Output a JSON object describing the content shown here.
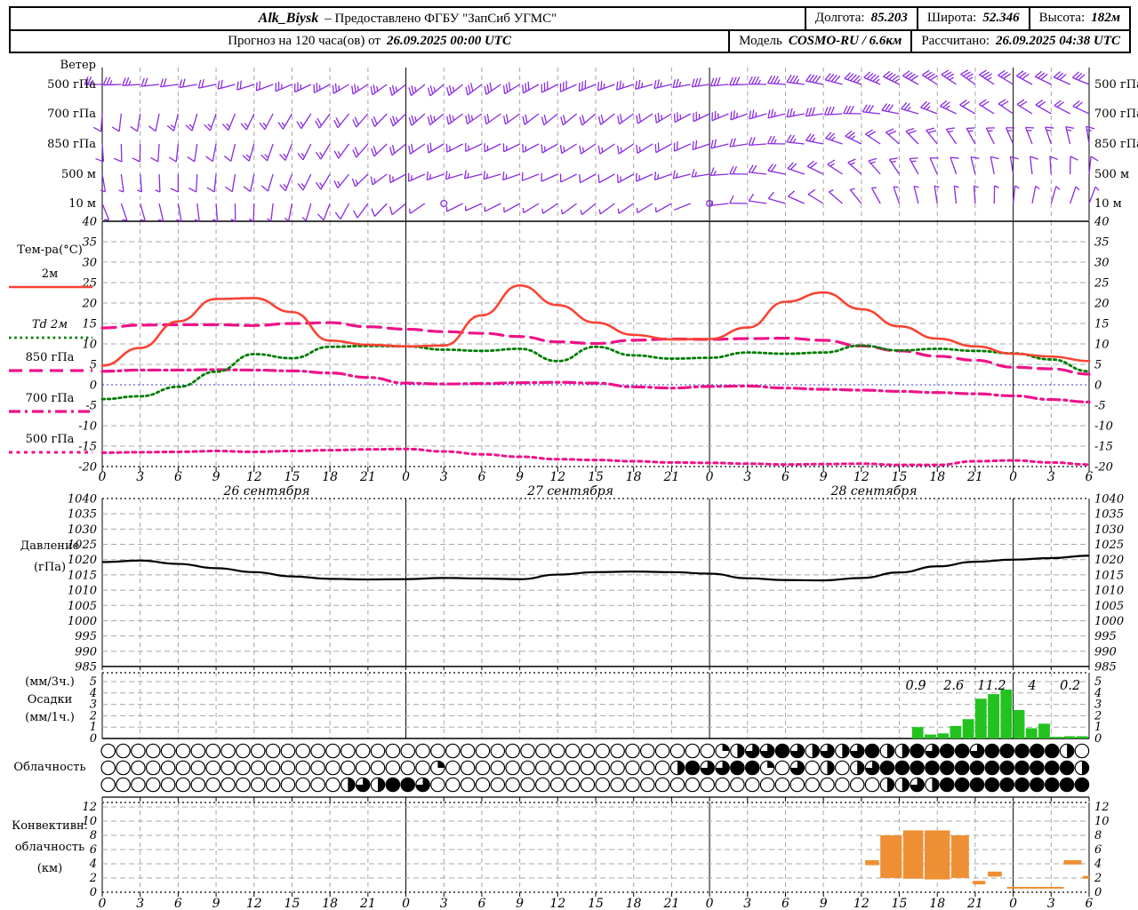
{
  "header": {
    "station": "Alk_Biysk",
    "provider": "–  Предоставлено ФГБУ \"ЗапСиб УГМС\"",
    "lon_label": "Долгота:",
    "lon": "85.203",
    "lat_label": "Широта:",
    "lat": "52.346",
    "alt_label": "Высота:",
    "alt": "182м",
    "forecast_label": "Прогноз на 120 часа(ов) от",
    "forecast_start": "26.09.2025 00:00 UTC",
    "model_label": "Модель",
    "model": "COSMO-RU / 6.6км",
    "calc_label": "Рассчитано:",
    "calc_time": "26.09.2025 04:38 UTC"
  },
  "panels": {
    "wind": {
      "title": "Ветер",
      "levels": [
        "500 гПа",
        "700 гПа",
        "850 гПа",
        "500 м",
        "10 м"
      ]
    },
    "temp": {
      "title": "Тем-ра(°C)",
      "legend": [
        "2м",
        "Td  2м",
        "850 гПа",
        "700 гПа",
        "500 гПа"
      ]
    },
    "pressure": {
      "line1": "Давление",
      "line2": "(гПа)"
    },
    "precip": {
      "line1": "(мм/3ч.)",
      "line2": "Осадки",
      "line3": "(мм/1ч.)"
    },
    "cloud": {
      "title": "Облачность"
    },
    "conv": {
      "line1": "Конвективн.",
      "line2": "облачность",
      "line3": "(км)"
    }
  },
  "chart_data": {
    "type": "meteogram",
    "x_hours": {
      "start": 0,
      "end": 78,
      "step": 3
    },
    "x_tick_labels": [
      "0",
      "3",
      "6",
      "9",
      "12",
      "15",
      "18",
      "21",
      "0",
      "3",
      "6",
      "9",
      "12",
      "15",
      "18",
      "21",
      "0",
      "3",
      "6",
      "9",
      "12",
      "15",
      "18",
      "21",
      "0",
      "3",
      "6"
    ],
    "dates": [
      "26 сентября",
      "27 сентября",
      "28 сентября"
    ],
    "colors": {
      "wind": "#8a2be2",
      "temp2m": "#f94334",
      "dewpoint": "#007c00",
      "pink": "#ee1289",
      "pressure": "#000000",
      "precip": "#22c31f",
      "conv": "#ef8f33",
      "grid": "#a8a8a8",
      "zero_line": "#3333ee"
    },
    "temperature": {
      "ylim": [
        -20,
        40
      ],
      "yticks": [
        40,
        35,
        30,
        25,
        20,
        15,
        10,
        5,
        0,
        -5,
        -10,
        -15,
        -20
      ],
      "series": [
        {
          "name": "2м",
          "style": "solid",
          "color": "#f94334",
          "values": [
            4.7,
            9,
            15.5,
            21,
            21.2,
            17.8,
            10.8,
            9.8,
            9.4,
            9.6,
            17,
            24.3,
            19.5,
            15.2,
            12.2,
            11.1,
            11.2,
            14,
            20.3,
            22.6,
            18.5,
            14.3,
            11.3,
            9.4,
            7.6,
            6.9,
            5.8
          ]
        },
        {
          "name": "Td 2м",
          "style": "dotted",
          "color": "#007c00",
          "values": [
            -3.5,
            -2.8,
            -0.5,
            3.2,
            7.5,
            6.5,
            9.3,
            9.5,
            9.4,
            8.6,
            8.3,
            8.8,
            5.8,
            9.3,
            7.2,
            6.4,
            6.6,
            7.9,
            7.6,
            7.9,
            9.6,
            8.4,
            8.8,
            8.3,
            7.7,
            6.2,
            3.3
          ]
        },
        {
          "name": "850 гПа",
          "style": "longdash",
          "color": "#ee1289",
          "values": [
            13.9,
            14.6,
            14.7,
            14.7,
            14.5,
            15.0,
            15.2,
            14.2,
            13.6,
            13.0,
            12.6,
            11.8,
            10.5,
            10.1,
            10.9,
            11.2,
            11.1,
            11.3,
            11.4,
            10.9,
            9.5,
            8.3,
            7.0,
            6.0,
            4.3,
            3.9,
            2.6
          ]
        },
        {
          "name": "700 гПа",
          "style": "dashdot",
          "color": "#ee1289",
          "values": [
            3.3,
            3.6,
            3.6,
            3.7,
            3.6,
            3.4,
            2.9,
            1.8,
            0.4,
            0.2,
            0.3,
            0.5,
            0.6,
            0.4,
            -0.5,
            -0.8,
            -0.4,
            -0.3,
            -0.8,
            -1.1,
            -1.3,
            -1.6,
            -1.9,
            -2.2,
            -2.7,
            -3.6,
            -4.2
          ]
        },
        {
          "name": "500 гПа",
          "style": "shortdash",
          "color": "#ee1289",
          "values": [
            -16.6,
            -16.5,
            -16.4,
            -16.2,
            -16.4,
            -16.2,
            -16.0,
            -15.8,
            -15.7,
            -16.3,
            -17.0,
            -17.6,
            -18.2,
            -18.4,
            -18.7,
            -19.0,
            -19.1,
            -19.3,
            -19.5,
            -19.4,
            -19.3,
            -19.6,
            -19.6,
            -18.7,
            -18.5,
            -19.0,
            -19.5
          ]
        }
      ]
    },
    "pressure": {
      "ylim": [
        985,
        1040
      ],
      "yticks": [
        1040,
        1035,
        1030,
        1025,
        1020,
        1015,
        1010,
        1005,
        1000,
        995,
        990,
        985
      ],
      "values": [
        1019.2,
        1019.7,
        1018.6,
        1017.2,
        1015.9,
        1014.5,
        1013.7,
        1013.5,
        1013.6,
        1014.0,
        1013.8,
        1013.6,
        1015.1,
        1015.9,
        1016.1,
        1015.9,
        1015.4,
        1013.9,
        1013.3,
        1013.2,
        1014.0,
        1015.8,
        1017.8,
        1019.3,
        1020.0,
        1020.5,
        1021.3
      ]
    },
    "precip": {
      "ylim": [
        0,
        5
      ],
      "yticks": [
        5,
        4,
        3,
        2,
        1,
        0
      ],
      "bars_1h": [
        {
          "h": 64,
          "v": 1.0
        },
        {
          "h": 65,
          "v": 0.35
        },
        {
          "h": 66,
          "v": 0.45
        },
        {
          "h": 67,
          "v": 1.1
        },
        {
          "h": 68,
          "v": 1.7
        },
        {
          "h": 69,
          "v": 3.5
        },
        {
          "h": 70,
          "v": 3.9
        },
        {
          "h": 71,
          "v": 4.3
        },
        {
          "h": 72,
          "v": 2.5
        },
        {
          "h": 73,
          "v": 0.9
        },
        {
          "h": 74,
          "v": 1.3
        },
        {
          "h": 75,
          "v": 0.15
        },
        {
          "h": 76,
          "v": 0.2
        },
        {
          "h": 77,
          "v": 0.2
        }
      ],
      "sums_3h": [
        {
          "h": 64.3,
          "label": "0.9"
        },
        {
          "h": 67.3,
          "label": "2.6"
        },
        {
          "h": 70.3,
          "label": "11.2"
        },
        {
          "h": 73.5,
          "label": "4"
        },
        {
          "h": 76.5,
          "label": "0.2"
        }
      ]
    },
    "cloud_rows_eighths": [
      [
        0,
        0,
        0,
        0,
        0,
        0,
        0,
        0,
        0,
        0,
        0,
        0,
        0,
        0,
        0,
        0,
        0,
        0,
        0,
        0,
        0,
        0,
        0,
        0,
        0,
        0,
        0,
        0,
        0,
        0,
        0,
        0,
        0,
        0,
        0,
        0,
        0,
        0,
        0,
        0,
        0,
        2,
        4,
        6,
        6,
        8,
        6,
        4,
        6,
        4,
        6,
        8,
        4,
        4,
        8,
        6,
        8,
        8,
        6,
        8,
        8,
        8,
        8,
        8,
        4,
        0
      ],
      [
        0,
        0,
        0,
        0,
        0,
        0,
        0,
        0,
        0,
        0,
        0,
        0,
        0,
        0,
        0,
        0,
        0,
        0,
        0,
        0,
        0,
        0,
        2,
        0,
        0,
        0,
        0,
        0,
        0,
        0,
        0,
        0,
        0,
        0,
        0,
        0,
        0,
        0,
        4,
        8,
        6,
        6,
        8,
        8,
        2,
        0,
        6,
        0,
        4,
        0,
        4,
        6,
        8,
        8,
        8,
        8,
        8,
        8,
        8,
        8,
        8,
        8,
        8,
        8,
        8,
        4
      ],
      [
        0,
        0,
        0,
        0,
        0,
        0,
        0,
        0,
        0,
        0,
        0,
        0,
        0,
        0,
        0,
        0,
        4,
        6,
        4,
        8,
        8,
        6,
        0,
        0,
        0,
        0,
        0,
        0,
        0,
        0,
        0,
        0,
        0,
        0,
        0,
        0,
        0,
        0,
        0,
        0,
        0,
        0,
        0,
        0,
        0,
        0,
        0,
        0,
        0,
        0,
        0,
        0,
        4,
        4,
        6,
        4,
        8,
        8,
        8,
        8,
        8,
        8,
        8,
        8,
        8,
        8
      ]
    ],
    "conv_cloud": {
      "ylim": [
        0,
        13
      ],
      "yticks": [
        12,
        10,
        8,
        6,
        4,
        2,
        0
      ],
      "blocks_km": [
        {
          "h0": 60.3,
          "h1": 61.4,
          "base": 3.8,
          "top": 4.5
        },
        {
          "h0": 61.5,
          "h1": 63.2,
          "base": 2.0,
          "top": 8.0
        },
        {
          "h0": 63.3,
          "h1": 64.9,
          "base": 1.9,
          "top": 8.7
        },
        {
          "h0": 65.0,
          "h1": 67.0,
          "base": 1.8,
          "top": 8.7
        },
        {
          "h0": 67.1,
          "h1": 68.5,
          "base": 2.0,
          "top": 8.0
        },
        {
          "h0": 68.8,
          "h1": 69.8,
          "base": 1.1,
          "top": 1.6
        },
        {
          "h0": 70.0,
          "h1": 71.1,
          "base": 2.2,
          "top": 2.9
        },
        {
          "h0": 71.5,
          "h1": 76.0,
          "base": 0.5,
          "top": 0.75
        },
        {
          "h0": 76.0,
          "h1": 77.4,
          "base": 3.9,
          "top": 4.5
        },
        {
          "h0": 77.5,
          "h1": 78.0,
          "base": 1.9,
          "top": 2.3
        }
      ]
    },
    "wind_mps": {
      "levels": [
        {
          "name": "500 гПа",
          "dir": [
            270,
            266,
            262,
            258,
            252,
            247,
            242,
            237,
            232,
            230,
            233,
            238,
            243,
            248,
            252,
            257,
            262,
            268,
            274,
            281,
            289,
            296,
            302,
            305,
            301,
            296,
            292
          ],
          "spd": [
            13,
            12,
            10,
            10,
            11,
            12,
            12,
            13,
            14,
            14,
            15,
            16,
            16,
            15,
            14,
            14,
            15,
            16,
            18,
            20,
            22,
            22,
            20,
            18,
            16,
            15,
            16
          ]
        },
        {
          "name": "700 гПа",
          "dir": [
            184,
            189,
            194,
            199,
            205,
            210,
            216,
            221,
            226,
            231,
            235,
            234,
            231,
            230,
            234,
            239,
            244,
            250,
            256,
            262,
            271,
            281,
            291,
            300,
            304,
            300,
            295
          ],
          "spd": [
            6,
            6,
            7,
            8,
            8,
            9,
            10,
            11,
            12,
            12,
            12,
            11,
            10,
            10,
            11,
            12,
            12,
            13,
            14,
            15,
            16,
            15,
            13,
            11,
            10,
            10,
            11
          ]
        },
        {
          "name": "850 гПа",
          "dir": [
            176,
            181,
            186,
            191,
            196,
            202,
            211,
            221,
            231,
            240,
            245,
            244,
            240,
            236,
            236,
            241,
            251,
            261,
            271,
            281,
            296,
            311,
            321,
            331,
            336,
            341,
            351
          ],
          "spd": [
            5,
            5,
            6,
            6,
            7,
            8,
            9,
            10,
            10,
            10,
            9,
            8,
            8,
            8,
            9,
            10,
            10,
            11,
            12,
            12,
            12,
            11,
            10,
            9,
            8,
            8,
            9
          ]
        },
        {
          "name": "500 м",
          "dir": [
            170,
            175,
            180,
            186,
            192,
            201,
            211,
            226,
            241,
            251,
            256,
            251,
            246,
            241,
            241,
            251,
            261,
            271,
            281,
            296,
            311,
            326,
            336,
            346,
            351,
            356,
            366
          ],
          "spd": [
            4,
            4,
            5,
            5,
            6,
            7,
            8,
            9,
            9,
            8,
            7,
            7,
            6,
            6,
            7,
            8,
            9,
            10,
            10,
            10,
            9,
            8,
            6,
            5,
            5,
            5,
            6
          ]
        },
        {
          "name": "10 м",
          "dir": [
            158,
            164,
            170,
            176,
            182,
            191,
            201,
            216,
            231,
            241,
            246,
            241,
            236,
            231,
            236,
            241,
            256,
            271,
            286,
            301,
            321,
            341,
            351,
            356,
            366,
            376,
            381
          ],
          "spd": [
            2,
            2,
            3,
            3,
            4,
            4,
            5,
            5,
            5,
            0,
            4,
            3,
            3,
            2,
            2,
            3,
            0,
            5,
            5,
            5,
            4,
            4,
            3,
            3,
            3,
            4,
            4
          ]
        }
      ]
    }
  }
}
